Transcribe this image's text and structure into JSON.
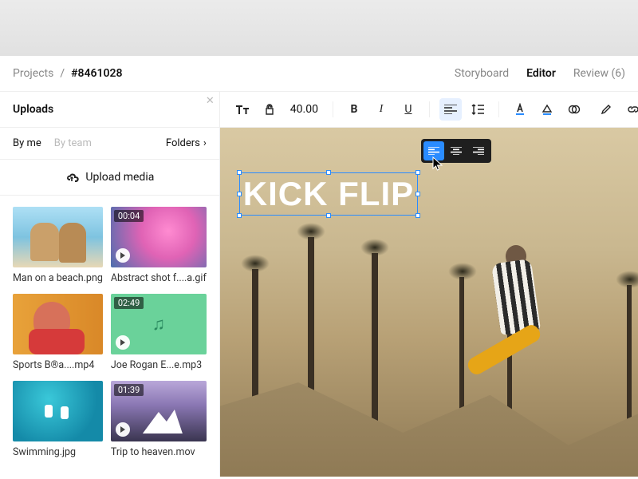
{
  "breadcrumb": {
    "root": "Projects",
    "sep": "/",
    "current": "#8461028"
  },
  "tabs": {
    "storyboard": "Storyboard",
    "editor": "Editor",
    "review": "Review (6)"
  },
  "sidebar": {
    "title": "Uploads",
    "filter_by_me": "By me",
    "filter_by_team": "By team",
    "folders": "Folders",
    "upload_label": "Upload media",
    "items": [
      {
        "caption": "Man on a beach.png",
        "badge": ""
      },
      {
        "caption": "Abstract shot f....a.gif",
        "badge": "00:04"
      },
      {
        "caption": "Sports B®a....mp4",
        "badge": ""
      },
      {
        "caption": "Joe Rogan E...e.mp3",
        "badge": "02:49"
      },
      {
        "caption": "Swimming.jpg",
        "badge": ""
      },
      {
        "caption": "Trip to heaven.mov",
        "badge": "01:39"
      }
    ]
  },
  "toolbar": {
    "font_size": "40.00"
  },
  "canvas": {
    "title_text": "KICK FLIP"
  }
}
